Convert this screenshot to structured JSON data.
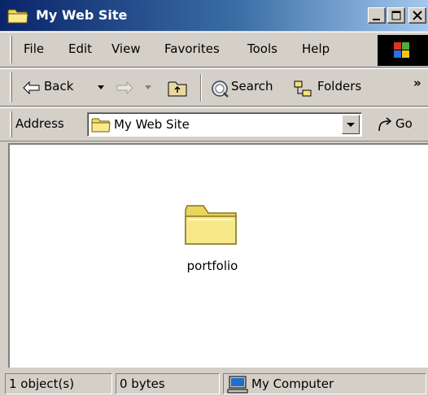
{
  "window": {
    "title": "My Web Site"
  },
  "menu": {
    "items": [
      "File",
      "Edit",
      "View",
      "Favorites",
      "Tools",
      "Help"
    ]
  },
  "toolbar": {
    "back": "Back",
    "search": "Search",
    "folders": "Folders",
    "more": "»"
  },
  "address": {
    "label": "Address",
    "value": "My Web Site",
    "go": "Go"
  },
  "content": {
    "items": [
      {
        "name": "portfolio",
        "icon": "folder-icon"
      }
    ]
  },
  "status": {
    "objects": "1 object(s)",
    "size": "0 bytes",
    "zone": "My Computer"
  },
  "colors": {
    "titlebar_start": "#0a246a",
    "titlebar_end": "#a6caf0",
    "face": "#d4d0c8",
    "folder": "#f3e27a"
  }
}
